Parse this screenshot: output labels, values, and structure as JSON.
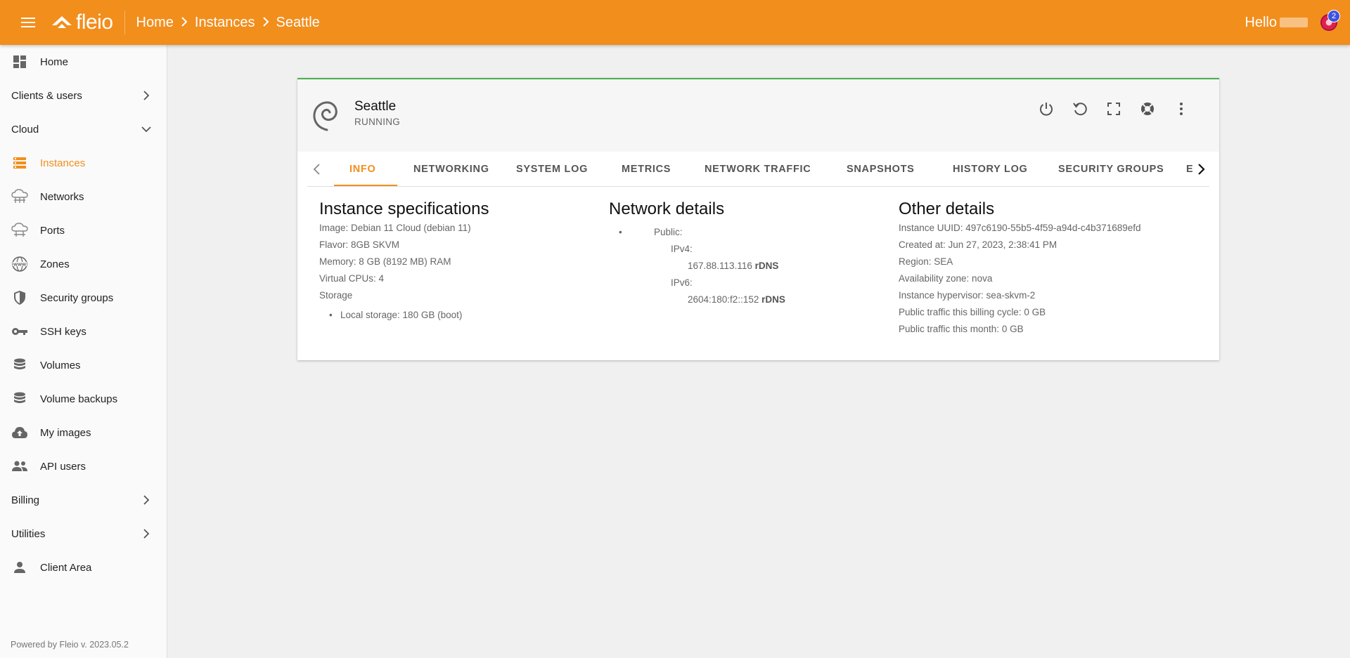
{
  "topbar": {
    "logo_text": "fleio",
    "breadcrumbs": [
      "Home",
      "Instances",
      "Seattle"
    ],
    "greeting": "Hello",
    "notification_count": "2",
    "accent": "#f28e1c"
  },
  "sidebar": {
    "items": [
      {
        "label": "Home",
        "icon": "dashboard-icon"
      },
      {
        "label": "Clients & users",
        "icon": "chevron-right-icon"
      },
      {
        "label": "Cloud",
        "icon": "chevron-down-icon"
      },
      {
        "label": "Instances",
        "icon": "server-icon"
      },
      {
        "label": "Networks",
        "icon": "network-cloud-icon"
      },
      {
        "label": "Ports",
        "icon": "port-cloud-icon"
      },
      {
        "label": "Zones",
        "icon": "www-globe-icon"
      },
      {
        "label": "Security groups",
        "icon": "shield-icon"
      },
      {
        "label": "SSH keys",
        "icon": "key-icon"
      },
      {
        "label": "Volumes",
        "icon": "database-icon"
      },
      {
        "label": "Volume backups",
        "icon": "database-icon"
      },
      {
        "label": "My images",
        "icon": "cloud-upload-icon"
      },
      {
        "label": "API users",
        "icon": "people-icon"
      },
      {
        "label": "Billing",
        "icon": "chevron-right-icon"
      },
      {
        "label": "Utilities",
        "icon": "chevron-right-icon"
      },
      {
        "label": "Client Area",
        "icon": "person-icon"
      }
    ],
    "powered_by": "Powered by Fleio v. 2023.05.2"
  },
  "instance": {
    "name": "Seattle",
    "status": "RUNNING",
    "os_icon": "debian-swirl-icon",
    "actions": [
      "power-icon",
      "restart-icon",
      "fullscreen-icon",
      "rescue-icon",
      "more-vert-icon"
    ]
  },
  "tabs": [
    "INFO",
    "NETWORKING",
    "SYSTEM LOG",
    "METRICS",
    "NETWORK TRAFFIC",
    "SNAPSHOTS",
    "HISTORY LOG",
    "SECURITY GROUPS",
    "E"
  ],
  "specs": {
    "title": "Instance specifications",
    "image": "Image: Debian 11 Cloud (debian 11)",
    "flavor": "Flavor: 8GB SKVM",
    "memory": "Memory: 8 GB (8192 MB) RAM",
    "vcpus": "Virtual CPUs: 4",
    "storage_label": "Storage",
    "storage_item": "Local storage: 180 GB (boot)"
  },
  "network": {
    "title": "Network details",
    "public_label": "Public:",
    "ipv4_label": "IPv4:",
    "ipv4": "167.88.113.116",
    "ipv6_label": "IPv6:",
    "ipv6": "2604:180:f2::152",
    "rdns_label": "rDNS"
  },
  "other": {
    "title": "Other details",
    "uuid": "Instance UUID: 497c6190-55b5-4f59-a94d-c4b371689efd",
    "created": "Created at: Jun 27, 2023, 2:38:41 PM",
    "region": "Region: SEA",
    "zone": "Availability zone: nova",
    "hypervisor": "Instance hypervisor: sea-skvm-2",
    "traffic_cycle": "Public traffic this billing cycle: 0 GB",
    "traffic_month": "Public traffic this month: 0 GB"
  }
}
